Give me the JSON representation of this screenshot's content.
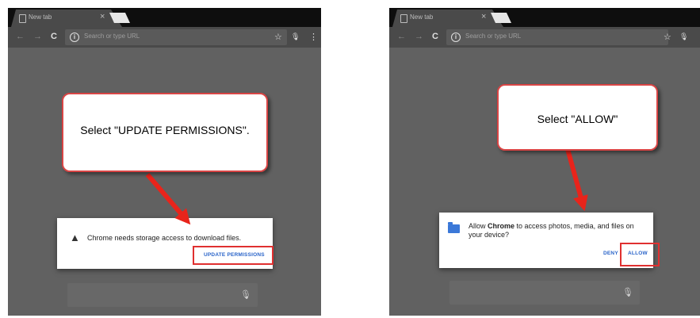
{
  "browser": {
    "tab_title": "New tab",
    "tab_close": "×",
    "omnibox_placeholder": "Search or type URL",
    "info_glyph": "i",
    "back_glyph": "←",
    "forward_glyph": "→",
    "reload_glyph": "C",
    "star_glyph": "☆",
    "mic_glyph": "🎙",
    "menu_glyph": "⋮"
  },
  "step1": {
    "callout": "Select \"UPDATE PERMISSIONS\".",
    "dialog_text": "Chrome needs storage access to download files.",
    "warn_glyph": "▲",
    "button_label": "UPDATE PERMISSIONS"
  },
  "step2": {
    "callout": "Select \"ALLOW\"",
    "dialog_text_pre": "Allow ",
    "dialog_text_bold": "Chrome",
    "dialog_text_post": " to access photos, media, and files on your device?",
    "deny_label": "DENY",
    "allow_label": "ALLOW"
  },
  "colors": {
    "callout_border": "#d94545",
    "highlight": "#e03030",
    "button_blue": "#2a64c9"
  },
  "icons": [
    "new-tab-icon",
    "info-icon",
    "star-icon",
    "mic-icon",
    "menu-icon",
    "warning-icon",
    "folder-icon",
    "arrow-icon"
  ]
}
